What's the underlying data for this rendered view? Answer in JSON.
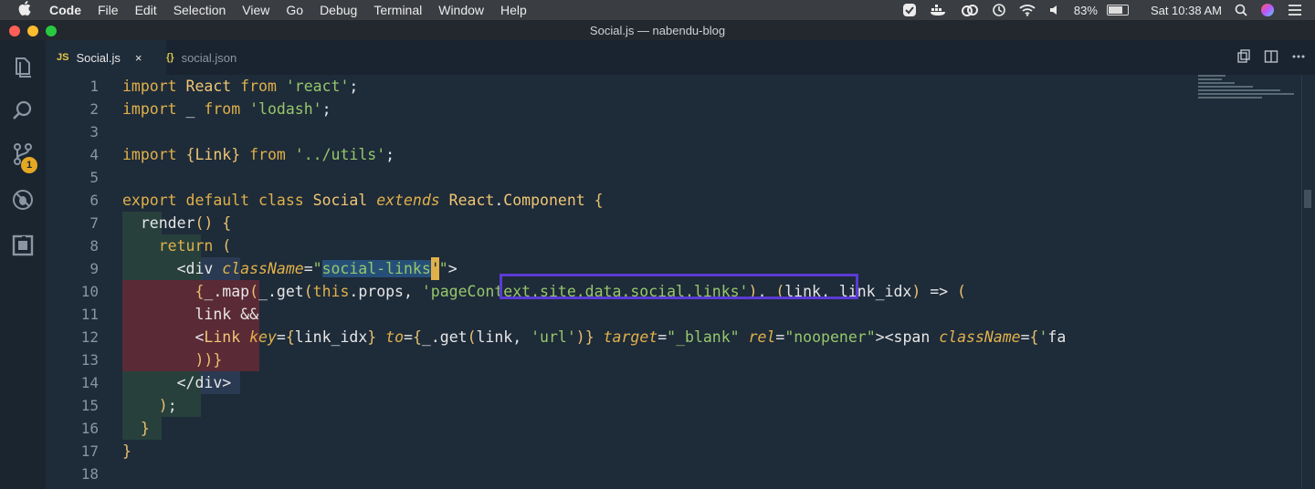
{
  "menubar": {
    "apple": "",
    "items": [
      "Code",
      "File",
      "Edit",
      "Selection",
      "View",
      "Go",
      "Debug",
      "Terminal",
      "Window",
      "Help"
    ],
    "battery_percent": "83%",
    "battery_level": 0.83,
    "clock": "Sat 10:38 AM"
  },
  "window": {
    "title": "Social.js — nabendu-blog"
  },
  "activity": {
    "scm_badge": "1"
  },
  "tabs": [
    {
      "icon": "JS",
      "label": "Social.js",
      "close": "×"
    },
    {
      "icon": "{}",
      "label": "social.json"
    }
  ],
  "editor": {
    "line_numbers": [
      "1",
      "2",
      "3",
      "4",
      "5",
      "6",
      "7",
      "8",
      "9",
      "10",
      "11",
      "12",
      "13",
      "14",
      "15",
      "16",
      "17",
      "18"
    ],
    "lines": [
      {
        "t": "import React from 'react';"
      },
      {
        "t": "import _ from 'lodash';"
      },
      {
        "t": ""
      },
      {
        "t": "import {Link} from '../utils';"
      },
      {
        "t": ""
      },
      {
        "t": "export default class Social extends React.Component {"
      },
      {
        "t": "  render() {"
      },
      {
        "t": "    return ("
      },
      {
        "t": "      <div className=\"social-links\">"
      },
      {
        "t": "        {_.map(_.get(this.props, 'pageContext.site.data.social.links'), (link, link_idx) => ("
      },
      {
        "t": "        link &&"
      },
      {
        "t": "        <Link key={link_idx} to={_.get(link, 'url')} target=\"_blank\" rel=\"noopener\"><span className={'fa"
      },
      {
        "t": "        ))}"
      },
      {
        "t": "      </div>"
      },
      {
        "t": "    );"
      },
      {
        "t": "  }"
      },
      {
        "t": "}"
      },
      {
        "t": ""
      }
    ]
  }
}
